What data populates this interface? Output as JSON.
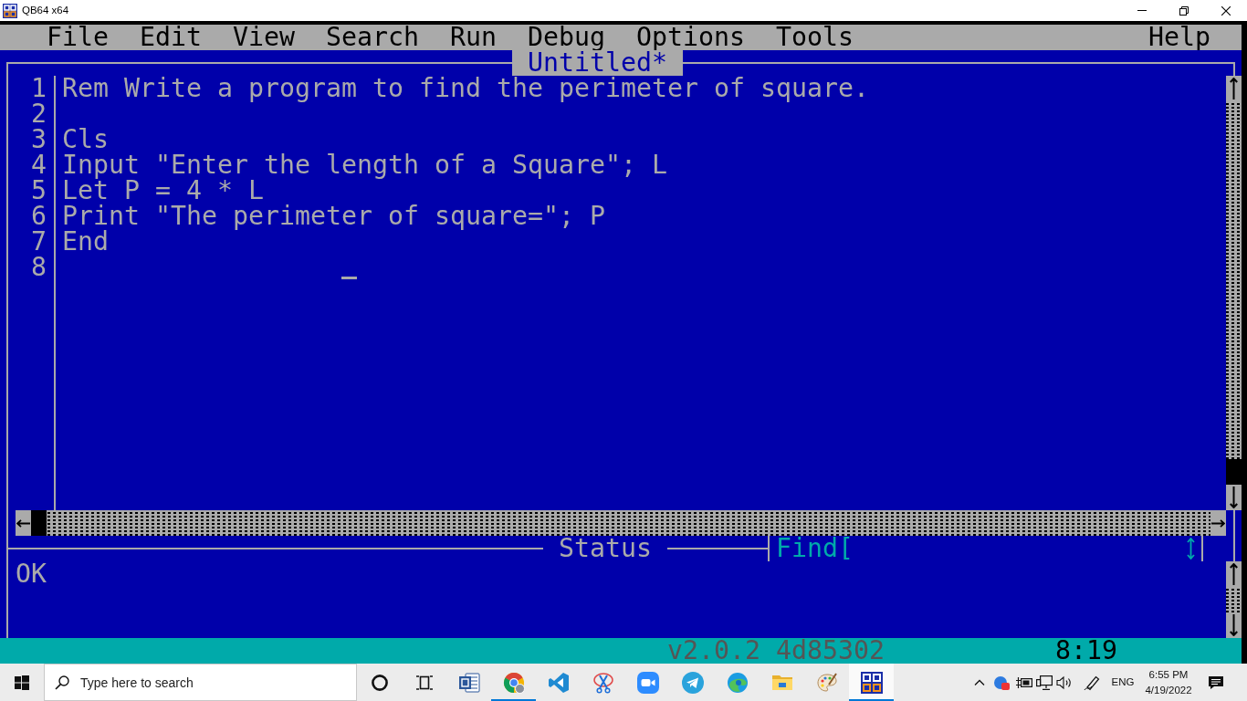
{
  "window": {
    "title": "QB64 x64"
  },
  "menu": {
    "left": [
      {
        "label": "File"
      },
      {
        "label": "Edit"
      },
      {
        "label": "View"
      },
      {
        "label": "Search"
      },
      {
        "label": "Run"
      },
      {
        "label": "Debug"
      },
      {
        "label": "Options"
      },
      {
        "label": "Tools"
      }
    ],
    "right": [
      {
        "label": "Help"
      }
    ]
  },
  "editor": {
    "title": "Untitled*",
    "lines": [
      {
        "number": "1",
        "text": "Rem Write a program to find the perimeter of square.",
        "cursor": false
      },
      {
        "number": "2",
        "cursor": false
      },
      {
        "number": "3",
        "text": "Cls",
        "cursor": false
      },
      {
        "number": "4",
        "text": "Input \"Enter the length of a Square\"; L",
        "cursor": false
      },
      {
        "number": "5",
        "text": "Let P = 4 * L",
        "cursor": false
      },
      {
        "number": "6",
        "text": "Print \"The perimeter of square=\"; P",
        "cursor": false
      },
      {
        "number": "7",
        "text": "End",
        "cursor": false
      },
      {
        "number": "8",
        "cursor": true
      }
    ]
  },
  "status": {
    "title": "Status",
    "message": "OK",
    "find": {
      "label": "Find["
    }
  },
  "status_bar": {
    "version": "v2.0.2 4d85302",
    "position": "8:19"
  },
  "taskbar": {
    "search": {
      "placeholder": "Type here to search"
    },
    "items": [
      {
        "kind": "cortana",
        "running": false,
        "selected": false
      },
      {
        "kind": "task-view",
        "running": false,
        "selected": false
      },
      {
        "kind": "word",
        "running": false,
        "selected": false
      },
      {
        "kind": "chrome",
        "running": true,
        "selected": false
      },
      {
        "kind": "vscode",
        "running": false,
        "selected": false
      },
      {
        "kind": "snip",
        "running": false,
        "selected": false
      },
      {
        "kind": "zoom",
        "running": false,
        "selected": false
      },
      {
        "kind": "telegram",
        "running": false,
        "selected": false
      },
      {
        "kind": "edge",
        "running": false,
        "selected": false
      },
      {
        "kind": "explorer",
        "running": false,
        "selected": false
      },
      {
        "kind": "paint",
        "running": false,
        "selected": false
      },
      {
        "kind": "qb64",
        "running": true,
        "selected": true
      }
    ],
    "language": "ENG",
    "time": "6:55 PM",
    "date": "4/19/2022"
  }
}
